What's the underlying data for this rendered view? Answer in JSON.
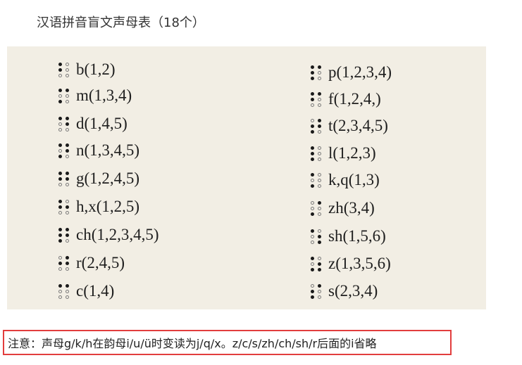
{
  "title": "汉语拼音盲文声母表（18个）",
  "colors": {
    "scan_bg": "#f2eee4",
    "note_border": "#e23d3d",
    "dot": "#1a1a1a"
  },
  "left_column": [
    {
      "label": "b(1,2)",
      "dots": [
        1,
        2
      ]
    },
    {
      "label": "m(1,3,4)",
      "dots": [
        1,
        3,
        4
      ]
    },
    {
      "label": "d(1,4,5)",
      "dots": [
        1,
        4,
        5
      ]
    },
    {
      "label": "n(1,3,4,5)",
      "dots": [
        1,
        3,
        4,
        5
      ]
    },
    {
      "label": "g(1,2,4,5)",
      "dots": [
        1,
        2,
        4,
        5
      ]
    },
    {
      "label": "h,x(1,2,5)",
      "dots": [
        1,
        2,
        5
      ]
    },
    {
      "label": "ch(1,2,3,4,5)",
      "dots": [
        1,
        2,
        3,
        4,
        5
      ]
    },
    {
      "label": "r(2,4,5)",
      "dots": [
        2,
        4,
        5
      ]
    },
    {
      "label": "c(1,4)",
      "dots": [
        1,
        4
      ]
    }
  ],
  "right_column": [
    {
      "label": "p(1,2,3,4)",
      "dots": [
        1,
        2,
        3,
        4
      ]
    },
    {
      "label": "f(1,2,4,)",
      "dots": [
        1,
        2,
        4
      ]
    },
    {
      "label": "t(2,3,4,5)",
      "dots": [
        2,
        3,
        4,
        5
      ]
    },
    {
      "label": "l(1,2,3)",
      "dots": [
        1,
        2,
        3
      ]
    },
    {
      "label": "k,q(1,3)",
      "dots": [
        1,
        3
      ]
    },
    {
      "label": "zh(3,4)",
      "dots": [
        3,
        4
      ]
    },
    {
      "label": "sh(1,5,6)",
      "dots": [
        1,
        5,
        6
      ]
    },
    {
      "label": "z(1,3,5,6)",
      "dots": [
        1,
        3,
        5,
        6
      ]
    },
    {
      "label": "s(2,3,4)",
      "dots": [
        2,
        3,
        4
      ]
    }
  ],
  "note": "注意：声母g/k/h在韵母i/u/ü时变读为j/q/x。z/c/s/zh/ch/sh/r后面的i省略"
}
